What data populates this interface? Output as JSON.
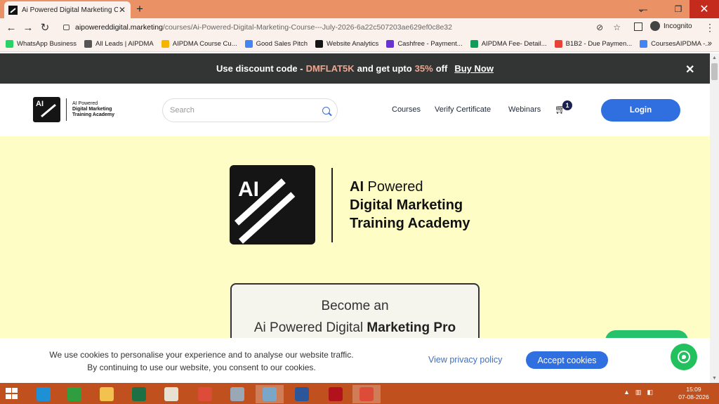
{
  "browser": {
    "tab_title": "Ai Powered Digital Marketing Co",
    "tab_close": "✕",
    "new_tab": "+",
    "window_controls": {
      "dropdown": "⌄",
      "minimize": "—",
      "maximize": "❐",
      "close": "✕"
    },
    "url_host": "aipowereddigital.marketing",
    "url_path": "/courses/Ai-Powered-Digital-Marketing-Course---July-2026-6a22c507203ae629ef0c8e32",
    "profile_label": "Incognito",
    "bookmarks": [
      {
        "label": "WhatsApp Business",
        "icon": "whatsapp-icon",
        "color": "#25d366"
      },
      {
        "label": "All Leads | AIPDMA",
        "icon": "page-icon",
        "color": "#555555"
      },
      {
        "label": "AIPDMA Course Cu...",
        "icon": "drive-icon",
        "color": "#f4b400"
      },
      {
        "label": "Good Sales Pitch",
        "icon": "docs-icon",
        "color": "#4285f4"
      },
      {
        "label": "Website Analytics",
        "icon": "ai-logo-icon",
        "color": "#151515"
      },
      {
        "label": "Cashfree - Payment...",
        "icon": "cashfree-icon",
        "color": "#6933d3"
      },
      {
        "label": "AIPDMA Fee- Detail...",
        "icon": "sheets-icon",
        "color": "#0f9d58"
      },
      {
        "label": "B1B2 - Due Paymen...",
        "icon": "google-icon",
        "color": "#ea4335"
      },
      {
        "label": "CoursesAIPDMA -...",
        "icon": "docs-icon",
        "color": "#4285f4"
      }
    ],
    "bookmarks_more": "»"
  },
  "promo": {
    "prefix": "Use discount code -",
    "code": "DMFLAT5K",
    "middle": "and get upto",
    "percent": "35%",
    "suffix": "off",
    "cta": "Buy Now",
    "close": "✕"
  },
  "header": {
    "logo_ai": "AI",
    "logo_line1": "AI Powered",
    "logo_line2": "Digital Marketing",
    "logo_line3": "Training Academy",
    "search_placeholder": "Search",
    "nav": [
      "Courses",
      "Verify Certificate",
      "Webinars"
    ],
    "cart_count": "1",
    "login": "Login"
  },
  "hero": {
    "logo_ai": "AI",
    "line1_bold": "AI",
    "line1_rest": " Powered",
    "line2": "Digital Marketing",
    "line3": "Training Academy",
    "card_line1": "Become an",
    "card_line2_a": "Ai Powered Digital",
    "card_line2_b": " Marketing Pro"
  },
  "cookie": {
    "text": "We use cookies to personalise your experience and to analyse our website traffic. By continuing to use our website, you consent to our cookies.",
    "privacy_link": "View privacy policy",
    "accept": "Accept cookies"
  },
  "colors": {
    "accent": "#2f6fdf",
    "promo_bg": "#333535",
    "promo_highlight": "#f2a48b",
    "hero_bg": "#fefdc6",
    "chrome_tabstrip": "#ea9166",
    "taskbar": "#c0511f",
    "whatsapp": "#22c15e"
  },
  "taskbar": {
    "apps": [
      {
        "name": "internet-explorer-icon",
        "color": "#1e90d6"
      },
      {
        "name": "store-icon",
        "color": "#2e9e3e"
      },
      {
        "name": "file-explorer-icon",
        "color": "#f2c14e"
      },
      {
        "name": "excel-icon",
        "color": "#1d7044"
      },
      {
        "name": "paint-icon",
        "color": "#e8e0d0"
      },
      {
        "name": "chrome-icon",
        "color": "#dd4b39"
      },
      {
        "name": "calculator-icon",
        "color": "#9aa7b5"
      },
      {
        "name": "notepad-icon",
        "color": "#7aa7c7"
      },
      {
        "name": "word-icon",
        "color": "#2b579a"
      },
      {
        "name": "media-icon",
        "color": "#b1121b"
      },
      {
        "name": "chrome-incognito-icon",
        "color": "#dd4b39"
      }
    ],
    "time": "15:09",
    "date": "07-08-2026"
  }
}
